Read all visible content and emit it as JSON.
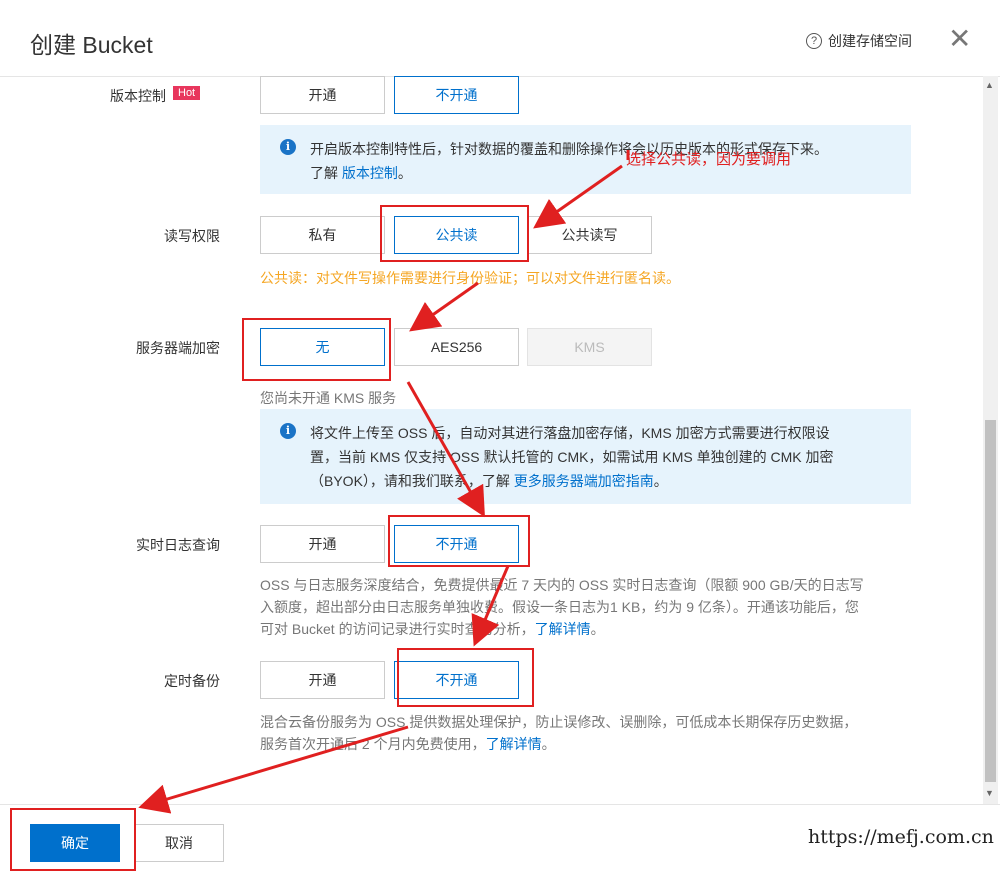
{
  "header": {
    "title": "创建 Bucket",
    "help_label": "创建存储空间",
    "help_icon": "?",
    "close_icon": "✕"
  },
  "versioning": {
    "label": "版本控制",
    "hot_badge": "Hot",
    "options": [
      "开通",
      "不开通"
    ],
    "selected": "不开通",
    "info_text": "开启版本控制特性后，针对数据的覆盖和删除操作将会以历史版本的形式保存下来。",
    "info_prefix": "了解",
    "info_link": "版本控制",
    "info_suffix": "。"
  },
  "acl": {
    "label": "读写权限",
    "options": [
      "私有",
      "公共读",
      "公共读写"
    ],
    "selected": "公共读",
    "warning": "公共读：对文件写操作需要进行身份验证；可以对文件进行匿名读。"
  },
  "encryption": {
    "label": "服务器端加密",
    "options": [
      "无",
      "AES256",
      "KMS"
    ],
    "selected": "无",
    "disabled": "KMS",
    "kms_hint": "您尚未开通 KMS 服务",
    "info_line1": "将文件上传至 OSS 后，自动对其进行落盘加密存储，KMS 加密方式需要进行权限设",
    "info_line2": "置，当前 KMS 仅支持 OSS 默认托管的 CMK，如需试用 KMS 单独创建的 CMK 加密",
    "info_line3_prefix": "（BYOK），请和我们联系，了解 ",
    "info_link": "更多服务器端加密指南",
    "info_suffix": "。"
  },
  "realtime_log": {
    "label": "实时日志查询",
    "options": [
      "开通",
      "不开通"
    ],
    "selected": "不开通",
    "desc_line1": "OSS 与日志服务深度结合，免费提供最近 7 天内的 OSS 实时日志查询（限额 900 GB/天的日志写",
    "desc_line2": "入额度，超出部分由日志服务单独收费。假设一条日志为1 KB，约为 9 亿条）。开通该功能后，您",
    "desc_line3_prefix": "可对 Bucket 的访问记录进行实时查询分析，",
    "desc_link": "了解详情",
    "desc_suffix": "。"
  },
  "backup": {
    "label": "定时备份",
    "options": [
      "开通",
      "不开通"
    ],
    "selected": "不开通",
    "desc_line1": "混合云备份服务为 OSS 提供数据处理保护，防止误修改、误删除，可低成本长期保存历史数据，",
    "desc_line2_prefix": "服务首次开通后 2 个月内免费使用，",
    "desc_link": "了解详情",
    "desc_suffix": "。"
  },
  "annotation": {
    "text": "选择公共读，因为要调用",
    "color": "#e02020"
  },
  "footer": {
    "ok_label": "确定",
    "cancel_label": "取消"
  },
  "watermark": "https://mefj.com.cn",
  "colors": {
    "accent": "#0070cc",
    "annotation_red": "#e02020",
    "hot_badge": "#e8365d",
    "warning_text": "#f5a623",
    "info_bg": "#e6f3fc"
  }
}
